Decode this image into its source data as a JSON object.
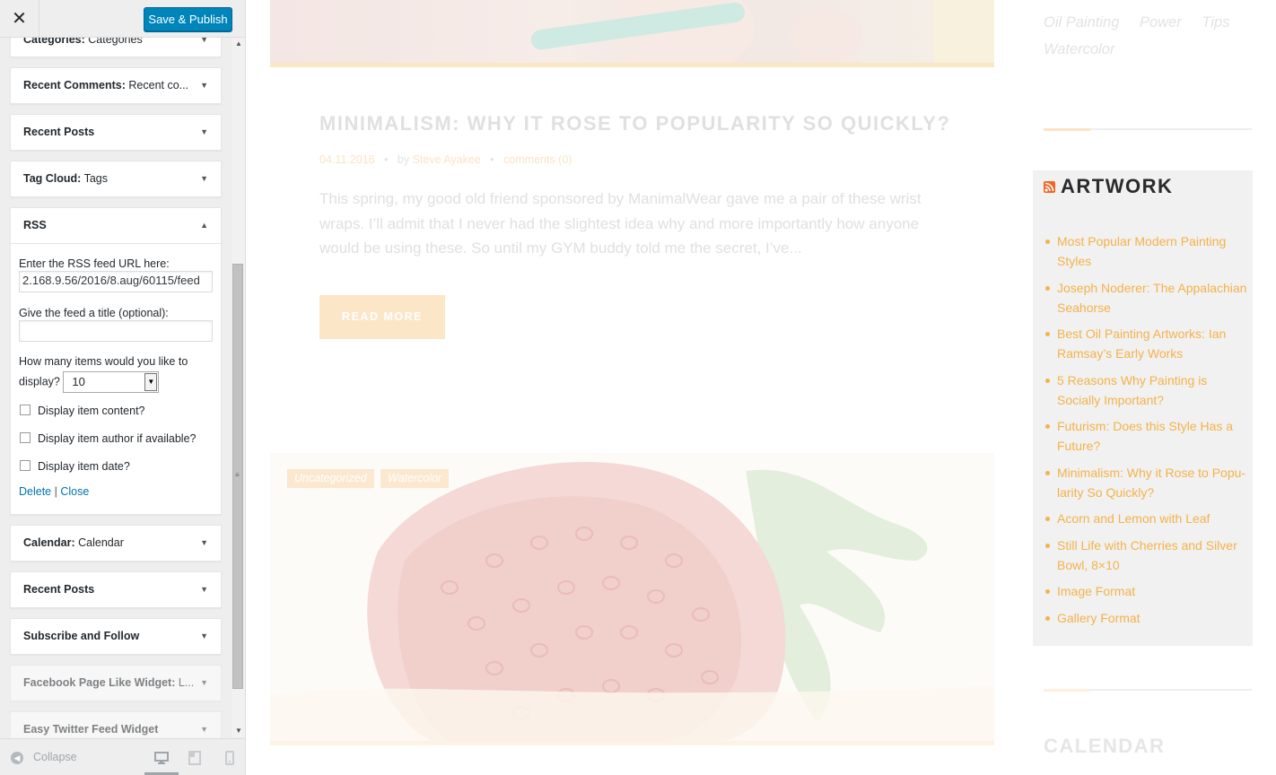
{
  "customizer": {
    "close_label": "✕",
    "save_label": "Save & Publish",
    "widgets_above": [
      {
        "title": "Categories:",
        "sub": " Categories"
      },
      {
        "title": "Recent Comments:",
        "sub": " Recent co..."
      },
      {
        "title": "Recent Posts",
        "sub": ""
      },
      {
        "title": "Tag Cloud:",
        "sub": " Tags"
      }
    ],
    "rss": {
      "title": "RSS",
      "url_label": "Enter the RSS feed URL here:",
      "url_value": "2.168.9.56/2016/8.aug/60115/feed",
      "feed_title_label": "Give the feed a title (optional):",
      "feed_title_value": "",
      "items_label_1": "How many items would you like to",
      "items_label_2": "display?",
      "items_value": "10",
      "opt_content": "Display item content?",
      "opt_author": "Display item author if available?",
      "opt_date": "Display item date?",
      "delete_label": "Delete",
      "separator": "|",
      "close_label": "Close"
    },
    "widgets_below": [
      {
        "title": "Calendar:",
        "sub": " Calendar"
      },
      {
        "title": "Recent Posts",
        "sub": ""
      },
      {
        "title": "Subscribe and Follow",
        "sub": ""
      },
      {
        "title": "Facebook Page Like Widget:",
        "sub": " L..."
      },
      {
        "title": "Easy Twitter Feed Widget",
        "sub": ""
      }
    ],
    "collapse_label": "Collapse",
    "accent_color": "#0085ba"
  },
  "preview": {
    "post_title": "MINIMALISM: WHY IT ROSE TO POPULARITY SO QUICKLY?",
    "post_date": "04.11.2016",
    "post_by": "by",
    "post_author": "Steve Ayakee",
    "post_comments": "comments (0)",
    "post_excerpt": "This spring, my good old friend sponsored by ManimalWear gave me a pair of these wrist wraps. I’ll admit that I never had the slightest idea why and more importantly how anyone would be using these. So until my GYM buddy told me the secret, I’ve...",
    "read_more": "READ MORE",
    "post_tags": [
      "Uncategorized",
      "Watercolor"
    ],
    "sidebar_tags": [
      "Oil Painting",
      "Power",
      "Tips",
      "Watercolor"
    ],
    "artwork_title": "ARTWORK",
    "artwork_items": [
      "Most Popular Modern Painting Styles",
      "Joseph Noderer: The Appalachian Seahorse",
      "Best Oil Painting Artworks: Ian Ramsay’s Early Works",
      "5 Reasons Why Painting is Socially Important?",
      "Futurism: Does this Style Has a Future?",
      "Minimalism: Why it Rose to Popu-larity So Quickly?",
      "Acorn and Lemon with Leaf",
      "Still Life with Cherries and Silver Bowl, 8×10",
      "Image Format",
      "Gallery Format"
    ],
    "calendar_title": "CALENDAR",
    "link_color": "#f4b24a"
  }
}
